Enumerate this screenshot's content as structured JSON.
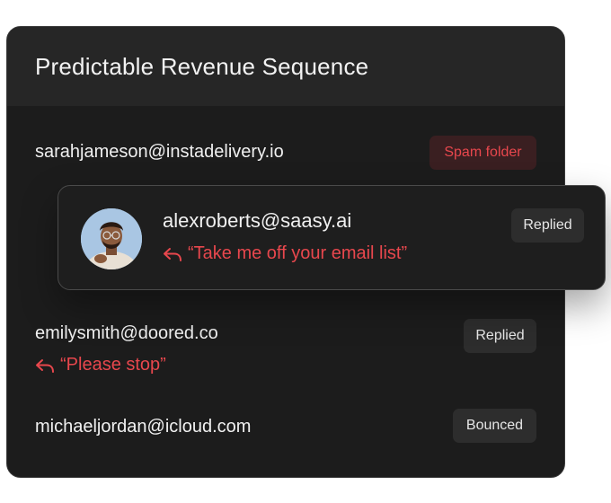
{
  "card": {
    "title": "Predictable Revenue Sequence"
  },
  "rows": [
    {
      "email": "sarahjameson@instadelivery.io",
      "status": "Spam folder"
    },
    {
      "email": "emilysmith@doored.co",
      "status": "Replied",
      "reply": "“Please stop”"
    },
    {
      "email": "michaeljordan@icloud.com",
      "status": "Bounced"
    }
  ],
  "popup": {
    "email": "alexroberts@saasy.ai",
    "status": "Replied",
    "reply": "“Take me off your email list”"
  },
  "icons": {
    "reply": "reply-arrow-icon"
  },
  "colors": {
    "card_bg": "#1c1c1c",
    "header_bg": "#262626",
    "accent_red": "#e8474d",
    "spam_badge_bg": "#3a1f21",
    "badge_bg": "#2d2d2d"
  }
}
